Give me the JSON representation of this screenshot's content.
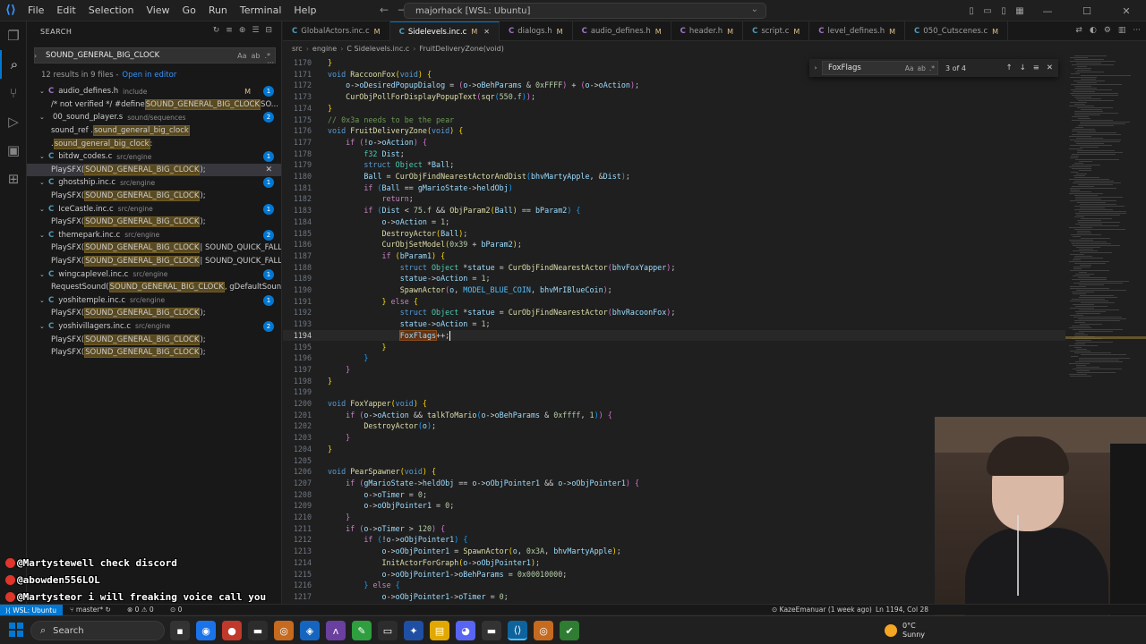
{
  "titlebar": {
    "menu": [
      "File",
      "Edit",
      "Selection",
      "View",
      "Go",
      "Run",
      "Terminal",
      "Help"
    ],
    "command_center": "majorhack [WSL: Ubuntu]"
  },
  "sidebar": {
    "header": "SEARCH",
    "search_value": "SOUND_GENERAL_BIG_CLOCK",
    "summary": "12 results in 9 files -",
    "open_in_editor": "Open in editor",
    "results": [
      {
        "name": "audio_defines.h",
        "path": "include",
        "modified": "M",
        "count": "1",
        "matches": [
          {
            "pre": "/* not verified */ #define ",
            "hl": "SOUND_GENERAL_BIG_CLOCK",
            "post": " SO..."
          }
        ]
      },
      {
        "name": "00_sound_player.s",
        "path": "sound/sequences",
        "count": "2",
        "icon": "asm",
        "matches": [
          {
            "pre": "sound_ref .",
            "hl": "sound_general_big_clock",
            "post": ""
          },
          {
            "pre": ".",
            "hl": "sound_general_big_clock",
            "post": ":"
          }
        ]
      },
      {
        "name": "bitdw_codes.c",
        "path": "src/engine",
        "count": "1",
        "matches": [
          {
            "pre": "PlaySFX(",
            "hl": "SOUND_GENERAL_BIG_CLOCK",
            "post": ");",
            "selected": true
          }
        ]
      },
      {
        "name": "ghostship.inc.c",
        "path": "src/engine",
        "count": "1",
        "matches": [
          {
            "pre": "PlaySFX(",
            "hl": "SOUND_GENERAL_BIG_CLOCK",
            "post": ");"
          }
        ]
      },
      {
        "name": "IceCastle.inc.c",
        "path": "src/engine",
        "count": "1",
        "matches": [
          {
            "pre": "PlaySFX(",
            "hl": "SOUND_GENERAL_BIG_CLOCK",
            "post": ");"
          }
        ]
      },
      {
        "name": "themepark.inc.c",
        "path": "src/engine",
        "count": "2",
        "matches": [
          {
            "pre": "PlaySFX(",
            "hl": "SOUND_GENERAL_BIG_CLOCK",
            "post": " | SOUND_QUICK_FALLOFF);"
          },
          {
            "pre": "PlaySFX(",
            "hl": "SOUND_GENERAL_BIG_CLOCK",
            "post": " | SOUND_QUICK_FALLOFF);"
          }
        ]
      },
      {
        "name": "wingcaplevel.inc.c",
        "path": "src/engine",
        "count": "1",
        "matches": [
          {
            "pre": "RequestSound(",
            "hl": "SOUND_GENERAL_BIG_CLOCK",
            "post": ", gDefaultSoundArgs);"
          }
        ]
      },
      {
        "name": "yoshitemple.inc.c",
        "path": "src/engine",
        "count": "1",
        "matches": [
          {
            "pre": "PlaySFX(",
            "hl": "SOUND_GENERAL_BIG_CLOCK",
            "post": ");"
          }
        ]
      },
      {
        "name": "yoshivillagers.inc.c",
        "path": "src/engine",
        "count": "2",
        "matches": [
          {
            "pre": "PlaySFX(",
            "hl": "SOUND_GENERAL_BIG_CLOCK",
            "post": ");"
          },
          {
            "pre": "PlaySFX(",
            "hl": "SOUND_GENERAL_BIG_CLOCK",
            "post": ");"
          }
        ]
      }
    ]
  },
  "tabs": [
    {
      "label": "GlobalActors.inc.c",
      "icon": "C",
      "modified": "M"
    },
    {
      "label": "Sidelevels.inc.c",
      "icon": "C",
      "modified": "M",
      "active": true
    },
    {
      "label": "dialogs.h",
      "icon": "h",
      "modified": "M"
    },
    {
      "label": "audio_defines.h",
      "icon": "h",
      "modified": "M"
    },
    {
      "label": "header.h",
      "icon": "h",
      "modified": "M"
    },
    {
      "label": "script.c",
      "icon": "C",
      "modified": "M"
    },
    {
      "label": "level_defines.h",
      "icon": "h",
      "modified": "M"
    },
    {
      "label": "050_Cutscenes.c",
      "icon": "C",
      "modified": "M"
    }
  ],
  "breadcrumb": [
    "src",
    "engine",
    "C Sidelevels.inc.c",
    "FruitDeliveryZone(void)"
  ],
  "find": {
    "value": "FoxFlags",
    "result": "3 of 4"
  },
  "editor": {
    "current_line": "1194",
    "lines": [
      {
        "n": "1170",
        "html": "<span class=\"br1\">}</span>"
      },
      {
        "n": "1171",
        "html": "<span class=\"kw\">void</span> <span class=\"fn\">RaccoonFox</span><span class=\"br1\">(</span><span class=\"kw\">void</span><span class=\"br1\">)</span> <span class=\"br1\">{</span>"
      },
      {
        "n": "1172",
        "html": "    <span class=\"vr\">o</span>-&gt;<span class=\"vr\">oDesiredPopupDialog</span> = <span class=\"br2\">(</span><span class=\"vr\">o</span>-&gt;<span class=\"vr\">oBehParams</span> &amp; <span class=\"nm\">0xFFFF</span><span class=\"br2\">)</span> + <span class=\"br2\">(</span><span class=\"vr\">o</span>-&gt;<span class=\"vr\">oAction</span><span class=\"br2\">)</span>;"
      },
      {
        "n": "1173",
        "html": "    <span class=\"fn\">CurObjPollForDisplayPopupText</span><span class=\"br2\">(</span><span class=\"fn\">sqr</span><span class=\"br3\">(</span><span class=\"nm\">550.f</span><span class=\"br3\">)</span><span class=\"br2\">)</span>;"
      },
      {
        "n": "1174",
        "html": "<span class=\"br1\">}</span>"
      },
      {
        "n": "1175",
        "html": "<span class=\"cm\">// 0x3a needs to be the pear</span>"
      },
      {
        "n": "1176",
        "html": "<span class=\"kw\">void</span> <span class=\"fn\">FruitDeliveryZone</span><span class=\"br1\">(</span><span class=\"kw\">void</span><span class=\"br1\">)</span> <span class=\"br1\">{</span>"
      },
      {
        "n": "1177",
        "html": "    <span class=\"cf\">if</span> <span class=\"br2\">(</span>!<span class=\"vr\">o</span>-&gt;<span class=\"vr\">oAction</span><span class=\"br2\">)</span> <span class=\"br2\">{</span>"
      },
      {
        "n": "1178",
        "html": "        <span class=\"ty\">f32</span> <span class=\"vr\">Dist</span>;"
      },
      {
        "n": "1179",
        "html": "        <span class=\"kw\">struct</span> <span class=\"ty\">Object</span> *<span class=\"vr\">Ball</span>;"
      },
      {
        "n": "1180",
        "html": "        <span class=\"vr\">Ball</span> = <span class=\"fn\">CurObjFindNearestActorAndDist</span><span class=\"br3\">(</span><span class=\"vr\">bhvMartyApple</span>, &amp;<span class=\"vr\">Dist</span><span class=\"br3\">)</span>;"
      },
      {
        "n": "1181",
        "html": "        <span class=\"cf\">if</span> <span class=\"br3\">(</span><span class=\"vr\">Ball</span> == <span class=\"vr\">gMarioState</span>-&gt;<span class=\"vr\">heldObj</span><span class=\"br3\">)</span>"
      },
      {
        "n": "1182",
        "html": "            <span class=\"cf\">return</span>;"
      },
      {
        "n": "1183",
        "html": "        <span class=\"cf\">if</span> <span class=\"br3\">(</span><span class=\"vr\">Dist</span> &lt; <span class=\"nm\">75.f</span> &amp;&amp; <span class=\"fn\">ObjParam2</span><span class=\"br1\">(</span><span class=\"vr\">Ball</span><span class=\"br1\">)</span> == <span class=\"vr\">bParam2</span><span class=\"br3\">)</span> <span class=\"br3\">{</span>"
      },
      {
        "n": "1184",
        "html": "            <span class=\"vr\">o</span>-&gt;<span class=\"vr\">oAction</span> = <span class=\"nm\">1</span>;"
      },
      {
        "n": "1185",
        "html": "            <span class=\"fn\">DestroyActor</span><span class=\"br1\">(</span><span class=\"vr\">Ball</span><span class=\"br1\">)</span>;"
      },
      {
        "n": "1186",
        "html": "            <span class=\"fn\">CurObjSetModel</span><span class=\"br1\">(</span><span class=\"nm\">0x39</span> + <span class=\"vr\">bParam2</span><span class=\"br1\">)</span>;"
      },
      {
        "n": "1187",
        "html": "            <span class=\"cf\">if</span> <span class=\"br1\">(</span><span class=\"vr\">bParam1</span><span class=\"br1\">)</span> <span class=\"br1\">{</span>"
      },
      {
        "n": "1188",
        "html": "                <span class=\"kw\">struct</span> <span class=\"ty\">Object</span> *<span class=\"vr\">statue</span> = <span class=\"fn\">CurObjFindNearestActor</span><span class=\"br2\">(</span><span class=\"vr\">bhvFoxYapper</span><span class=\"br2\">)</span>;"
      },
      {
        "n": "1189",
        "html": "                <span class=\"vr\">statue</span>-&gt;<span class=\"vr\">oAction</span> = <span class=\"nm\">1</span>;"
      },
      {
        "n": "1190",
        "html": "                <span class=\"fn\">SpawnActor</span><span class=\"br2\">(</span><span class=\"vr\">o</span>, <span class=\"mc\">MODEL_BLUE_COIN</span>, <span class=\"vr\">bhvMrIBlueCoin</span><span class=\"br2\">)</span>;"
      },
      {
        "n": "1191",
        "html": "            <span class=\"br1\">}</span> <span class=\"cf\">else</span> <span class=\"br1\">{</span>"
      },
      {
        "n": "1192",
        "html": "                <span class=\"kw\">struct</span> <span class=\"ty\">Object</span> *<span class=\"vr\">statue</span> = <span class=\"fn\">CurObjFindNearestActor</span><span class=\"br2\">(</span><span class=\"vr\">bhvRacoonFox</span><span class=\"br2\">)</span>;"
      },
      {
        "n": "1193",
        "html": "                <span class=\"vr\">statue</span>-&gt;<span class=\"vr\">oAction</span> = <span class=\"nm\">1</span>;"
      },
      {
        "n": "1194",
        "html": "                <span class=\"vr hlw\">FoxFlags</span>++;<span class=\"cursor\"></span>"
      },
      {
        "n": "1195",
        "html": "            <span class=\"br1\">}</span>"
      },
      {
        "n": "1196",
        "html": "        <span class=\"br3\">}</span>"
      },
      {
        "n": "1197",
        "html": "    <span class=\"br2\">}</span>"
      },
      {
        "n": "1198",
        "html": "<span class=\"br1\">}</span>"
      },
      {
        "n": "1199",
        "html": ""
      },
      {
        "n": "1200",
        "html": "<span class=\"kw\">void</span> <span class=\"fn\">FoxYapper</span><span class=\"br1\">(</span><span class=\"kw\">void</span><span class=\"br1\">)</span> <span class=\"br1\">{</span>"
      },
      {
        "n": "1201",
        "html": "    <span class=\"cf\">if</span> <span class=\"br2\">(</span><span class=\"vr\">o</span>-&gt;<span class=\"vr\">oAction</span> &amp;&amp; <span class=\"fn\">talkToMario</span><span class=\"br3\">(</span><span class=\"vr\">o</span>-&gt;<span class=\"vr\">oBehParams</span> &amp; <span class=\"nm\">0xffff</span>, <span class=\"nm\">1</span><span class=\"br3\">)</span><span class=\"br2\">)</span> <span class=\"br2\">{</span>"
      },
      {
        "n": "1202",
        "html": "        <span class=\"fn\">DestroyActor</span><span class=\"br3\">(</span><span class=\"vr\">o</span><span class=\"br3\">)</span>;"
      },
      {
        "n": "1203",
        "html": "    <span class=\"br2\">}</span>"
      },
      {
        "n": "1204",
        "html": "<span class=\"br1\">}</span>"
      },
      {
        "n": "1205",
        "html": ""
      },
      {
        "n": "1206",
        "html": "<span class=\"kw\">void</span> <span class=\"fn\">PearSpawner</span><span class=\"br1\">(</span><span class=\"kw\">void</span><span class=\"br1\">)</span> <span class=\"br1\">{</span>"
      },
      {
        "n": "1207",
        "html": "    <span class=\"cf\">if</span> <span class=\"br2\">(</span><span class=\"vr\">gMarioState</span>-&gt;<span class=\"vr\">heldObj</span> == <span class=\"vr\">o</span>-&gt;<span class=\"vr\">oObjPointer1</span> &amp;&amp; <span class=\"vr\">o</span>-&gt;<span class=\"vr\">oObjPointer1</span><span class=\"br2\">)</span> <span class=\"br2\">{</span>"
      },
      {
        "n": "1208",
        "html": "        <span class=\"vr\">o</span>-&gt;<span class=\"vr\">oTimer</span> = <span class=\"nm\">0</span>;"
      },
      {
        "n": "1209",
        "html": "        <span class=\"vr\">o</span>-&gt;<span class=\"vr\">oObjPointer1</span> = <span class=\"nm\">0</span>;"
      },
      {
        "n": "1210",
        "html": "    <span class=\"br2\">}</span>"
      },
      {
        "n": "1211",
        "html": "    <span class=\"cf\">if</span> <span class=\"br2\">(</span><span class=\"vr\">o</span>-&gt;<span class=\"vr\">oTimer</span> &gt; <span class=\"nm\">120</span><span class=\"br2\">)</span> <span class=\"br2\">{</span>"
      },
      {
        "n": "1212",
        "html": "        <span class=\"cf\">if</span> <span class=\"br3\">(</span>!<span class=\"vr\">o</span>-&gt;<span class=\"vr\">oObjPointer1</span><span class=\"br3\">)</span> <span class=\"br3\">{</span>"
      },
      {
        "n": "1213",
        "html": "            <span class=\"vr\">o</span>-&gt;<span class=\"vr\">oObjPointer1</span> = <span class=\"fn\">SpawnActor</span><span class=\"br1\">(</span><span class=\"vr\">o</span>, <span class=\"nm\">0x3A</span>, <span class=\"vr\">bhvMartyApple</span><span class=\"br1\">)</span>;"
      },
      {
        "n": "1214",
        "html": "            <span class=\"fn\">InitActorForGraph</span><span class=\"br1\">(</span><span class=\"vr\">o</span>-&gt;<span class=\"vr\">oObjPointer1</span><span class=\"br1\">)</span>;"
      },
      {
        "n": "1215",
        "html": "            <span class=\"vr\">o</span>-&gt;<span class=\"vr\">oObjPointer1</span>-&gt;<span class=\"vr\">oBehParams</span> = <span class=\"nm\">0x00010000</span>;"
      },
      {
        "n": "1216",
        "html": "        <span class=\"br3\">}</span> <span class=\"cf\">else</span> <span class=\"br3\">{</span>"
      },
      {
        "n": "1217",
        "html": "            <span class=\"vr\">o</span>-&gt;<span class=\"vr\">oObjPointer1</span>-&gt;<span class=\"vr\">oTimer</span> = <span class=\"nm\">0</span>;"
      }
    ]
  },
  "chat": [
    {
      "user": "@Martyste",
      "text": " well check discord"
    },
    {
      "user": "@abowden556",
      "text": " LOL"
    },
    {
      "user": "@Martyste",
      "text": " or i will freaking voice call you"
    }
  ],
  "statusbar": {
    "remote": "WSL: Ubuntu",
    "branch": "master*",
    "problems": "0 ⚠ 0",
    "ports": "0",
    "blame": "KazeEmanuar (1 week ago)",
    "position": "Ln 1194, Col 28"
  },
  "taskbar": {
    "search_placeholder": "Search",
    "weather_temp": "0°C",
    "weather_desc": "Sunny"
  }
}
